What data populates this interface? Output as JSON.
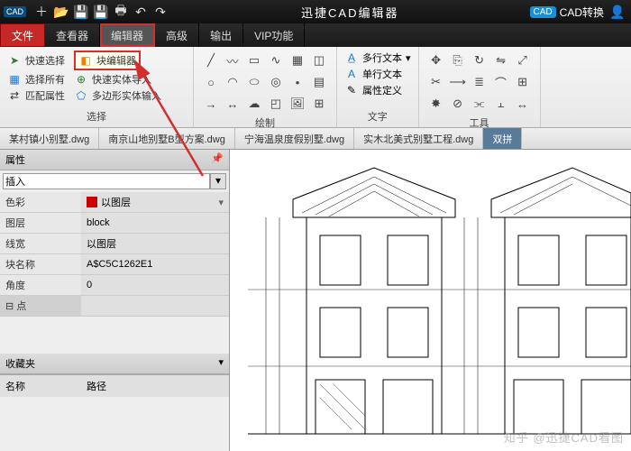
{
  "titlebar": {
    "logo": "CAD",
    "title": "迅捷CAD编辑器",
    "convert": "CAD转换"
  },
  "menu": {
    "file": "文件",
    "viewer": "查看器",
    "editor": "编辑器",
    "advanced": "高级",
    "output": "输出",
    "vip": "VIP功能"
  },
  "ribbon": {
    "select": {
      "quick": "快速选择",
      "block_editor": "块编辑器",
      "all": "选择所有",
      "entity_import": "快速实体导入",
      "match": "匹配属性",
      "polygon_input": "多边形实体输入",
      "title": "选择"
    },
    "draw_title": "绘制",
    "text": {
      "multi": "多行文本",
      "single": "单行文本",
      "attr_def": "属性定义",
      "title": "文字"
    },
    "tools_title": "工具"
  },
  "tabs": [
    "某村镇小别墅.dwg",
    "南京山地别墅B型方案.dwg",
    "宁海温泉度假别墅.dwg",
    "实木北美式别墅工程.dwg",
    "双拼"
  ],
  "props": {
    "panel_title": "属性",
    "insert": "插入",
    "color_k": "色彩",
    "color_v": "以图层",
    "layer_k": "图层",
    "layer_v": "block",
    "lw_k": "线宽",
    "lw_v": "以图层",
    "block_k": "块名称",
    "block_v": "A$C5C1262E1",
    "angle_k": "角度",
    "angle_v": "0",
    "point": "点"
  },
  "fav": {
    "title": "收藏夹",
    "name": "名称",
    "path": "路径"
  },
  "watermark": "知乎 @迅捷CAD看图"
}
